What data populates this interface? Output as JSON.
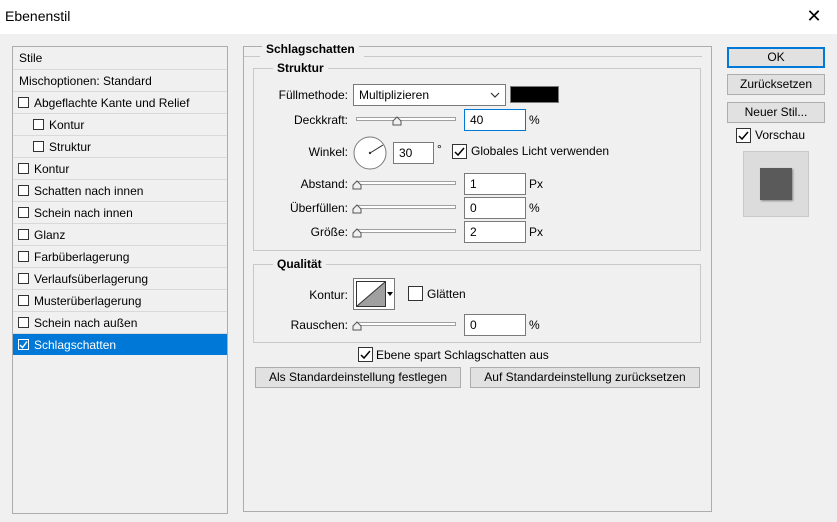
{
  "window": {
    "title": "Ebenenstil",
    "close_glyph": "✕"
  },
  "styles_list": {
    "header": "Stile",
    "blend_options": "Mischoptionen: Standard",
    "items": [
      {
        "label": "Abgeflachte Kante und Relief",
        "checked": false,
        "indent": false
      },
      {
        "label": "Kontur",
        "checked": false,
        "indent": true
      },
      {
        "label": "Struktur",
        "checked": false,
        "indent": true
      },
      {
        "label": "Kontur",
        "checked": false,
        "indent": false
      },
      {
        "label": "Schatten nach innen",
        "checked": false,
        "indent": false
      },
      {
        "label": "Schein nach innen",
        "checked": false,
        "indent": false
      },
      {
        "label": "Glanz",
        "checked": false,
        "indent": false
      },
      {
        "label": "Farbüberlagerung",
        "checked": false,
        "indent": false
      },
      {
        "label": "Verlaufsüberlagerung",
        "checked": false,
        "indent": false
      },
      {
        "label": "Musterüberlagerung",
        "checked": false,
        "indent": false
      },
      {
        "label": "Schein nach außen",
        "checked": false,
        "indent": false
      },
      {
        "label": "Schlagschatten",
        "checked": true,
        "indent": false,
        "selected": true
      }
    ]
  },
  "panel": {
    "title": "Schlagschatten",
    "structure": {
      "title": "Struktur",
      "blend_mode_label": "Füllmethode:",
      "blend_mode_value": "Multiplizieren",
      "color": "#000000",
      "opacity_label": "Deckkraft:",
      "opacity_value": "40",
      "opacity_unit": "%",
      "opacity_fraction": 0.4,
      "angle_label": "Winkel:",
      "angle_value": "30",
      "angle_unit": "°",
      "global_light_label": "Globales Licht verwenden",
      "global_light_checked": true,
      "distance_label": "Abstand:",
      "distance_value": "1",
      "distance_unit": "Px",
      "spread_label": "Überfüllen:",
      "spread_value": "0",
      "spread_unit": "%",
      "size_label": "Größe:",
      "size_value": "2",
      "size_unit": "Px"
    },
    "quality": {
      "title": "Qualität",
      "contour_label": "Kontur:",
      "antialias_label": "Glätten",
      "antialias_checked": false,
      "noise_label": "Rauschen:",
      "noise_value": "0",
      "noise_unit": "%"
    },
    "knockout_label": "Ebene spart Schlagschatten aus",
    "knockout_checked": true,
    "make_default": "Als Standardeinstellung festlegen",
    "reset_default": "Auf Standardeinstellung zurücksetzen"
  },
  "buttons": {
    "ok": "OK",
    "reset": "Zurücksetzen",
    "new_style": "Neuer Stil...",
    "preview_label": "Vorschau",
    "preview_checked": true
  },
  "icons": {
    "checkbox": "checkbox-icon",
    "dropdown": "chevron-down-icon",
    "angle": "angle-dial-icon",
    "contour": "contour-curve-icon",
    "slider": "slider-thumb-icon"
  }
}
